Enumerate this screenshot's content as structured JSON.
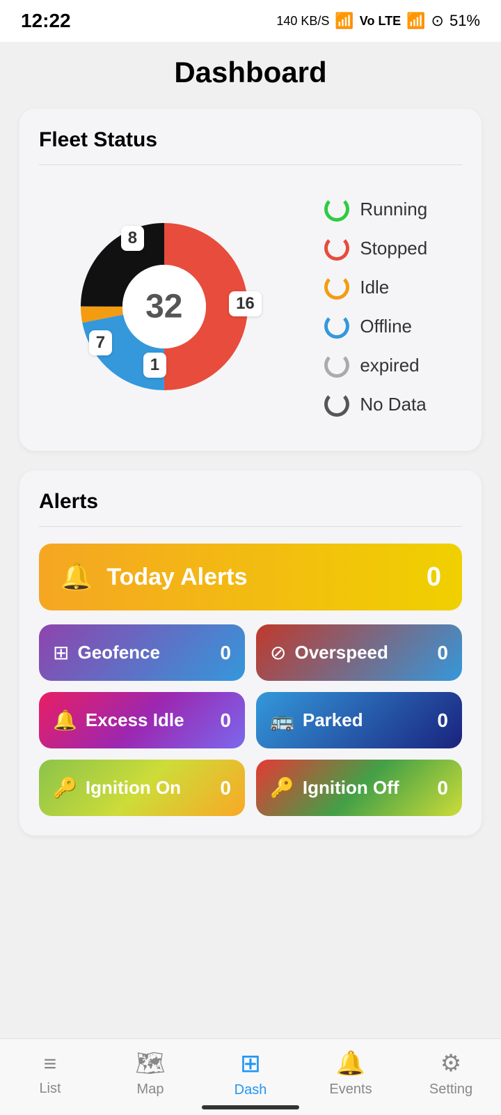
{
  "statusBar": {
    "time": "12:22",
    "signal": "140 KB/S",
    "battery": "51%"
  },
  "page": {
    "title": "Dashboard"
  },
  "fleetStatus": {
    "title": "Fleet Status",
    "total": "32",
    "segments": [
      {
        "label": "8",
        "position": "top",
        "color": "#111"
      },
      {
        "label": "16",
        "position": "right",
        "color": "#e74c3c"
      },
      {
        "label": "7",
        "position": "bottom-left",
        "color": "#3498db"
      },
      {
        "label": "1",
        "position": "bottom-center",
        "color": "#f39c12"
      }
    ],
    "legend": [
      {
        "name": "Running",
        "colorClass": "spinner-green"
      },
      {
        "name": "Stopped",
        "colorClass": "spinner-red"
      },
      {
        "name": "Idle",
        "colorClass": "spinner-orange"
      },
      {
        "name": "Offline",
        "colorClass": "spinner-blue"
      },
      {
        "name": "expired",
        "colorClass": "spinner-gray"
      },
      {
        "name": "No Data",
        "colorClass": "spinner-dark"
      }
    ]
  },
  "alerts": {
    "title": "Alerts",
    "todayBtn": {
      "label": "Today Alerts",
      "count": "0",
      "icon": "🔔"
    },
    "items": [
      {
        "label": "Geofence",
        "count": "0",
        "icon": "⊞",
        "btnClass": "btn-geofence"
      },
      {
        "label": "Overspeed",
        "count": "0",
        "icon": "⊘",
        "btnClass": "btn-overspeed"
      },
      {
        "label": "Excess Idle",
        "count": "0",
        "icon": "🔔",
        "btnClass": "btn-excess-idle"
      },
      {
        "label": "Parked",
        "count": "0",
        "icon": "🚌",
        "btnClass": "btn-parked"
      },
      {
        "label": "Ignition On",
        "count": "0",
        "icon": "🔑",
        "btnClass": "btn-ignition-on"
      },
      {
        "label": "Ignition Off",
        "count": "0",
        "icon": "🔑",
        "btnClass": "btn-ignition-off"
      }
    ]
  },
  "bottomNav": {
    "items": [
      {
        "label": "List",
        "icon": "≡",
        "active": false
      },
      {
        "label": "Map",
        "icon": "🗺",
        "active": false
      },
      {
        "label": "Dash",
        "icon": "⊞",
        "active": true
      },
      {
        "label": "Events",
        "icon": "🔔",
        "active": false
      },
      {
        "label": "Setting",
        "icon": "⚙",
        "active": false
      }
    ]
  }
}
